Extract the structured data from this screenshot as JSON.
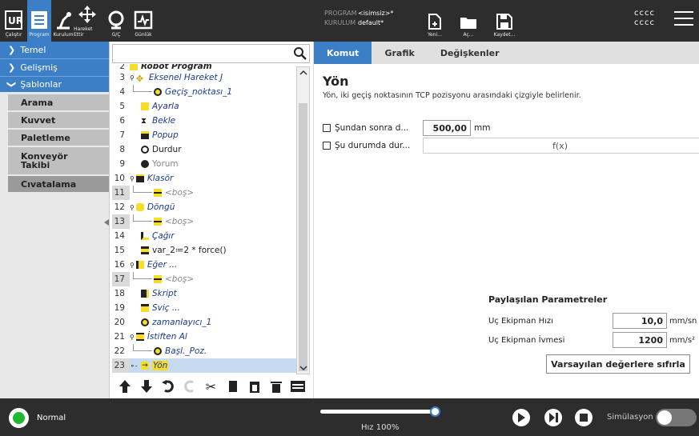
{
  "topbar": {
    "tabs": [
      {
        "label": "Çalıştır",
        "icon": "ur-logo-icon"
      },
      {
        "label": "Program",
        "icon": "program-icon"
      },
      {
        "label": "Kurulum",
        "icon": "installation-icon"
      },
      {
        "label": "Hareket Ettir",
        "icon": "move-icon"
      },
      {
        "label": "G/Ç",
        "icon": "io-icon"
      },
      {
        "label": "Günlük",
        "icon": "log-icon"
      }
    ],
    "program_key": "PROGRAM",
    "program_val": "<isimsiz>*",
    "install_key": "KURULUM",
    "install_val": "default*",
    "file_buttons": [
      {
        "label": "Yeni...",
        "icon": "new-file-icon"
      },
      {
        "label": "Aç...",
        "icon": "folder-icon"
      },
      {
        "label": "Kaydet...",
        "icon": "save-icon"
      }
    ],
    "user1": "cccc",
    "user2": "cccc"
  },
  "leftnav": {
    "top_items": [
      {
        "label": "Temel"
      },
      {
        "label": "Gelişmiş"
      },
      {
        "label": "Şablonlar"
      }
    ],
    "sub_items": [
      {
        "label": "Arama"
      },
      {
        "label": "Kuvvet"
      },
      {
        "label": "Paletleme"
      },
      {
        "label": "Konveyör Takibi"
      },
      {
        "label": "Cıvatalama"
      }
    ]
  },
  "tree": {
    "search_value": "",
    "rows": [
      {
        "n": "2",
        "label": "Robot Program",
        "icon": "robot-program-icon"
      },
      {
        "n": "3",
        "label": "Eksenel Hareket J",
        "icon": "move-icon"
      },
      {
        "n": "4",
        "label": "Geçiş_noktası_1",
        "icon": "waypoint-icon"
      },
      {
        "n": "5",
        "label": "Ayarla",
        "icon": "set-icon"
      },
      {
        "n": "6",
        "label": "Bekle",
        "icon": "wait-icon"
      },
      {
        "n": "7",
        "label": "Popup",
        "icon": "popup-icon"
      },
      {
        "n": "8",
        "label": "Durdur",
        "icon": "halt-icon"
      },
      {
        "n": "9",
        "label": "Yorum",
        "icon": "comment-icon"
      },
      {
        "n": "10",
        "label": "Klasör",
        "icon": "folder-icon"
      },
      {
        "n": "11",
        "label": "<boş>",
        "icon": "empty-icon"
      },
      {
        "n": "12",
        "label": "Döngü",
        "icon": "loop-icon"
      },
      {
        "n": "13",
        "label": "<boş>",
        "icon": "empty-icon"
      },
      {
        "n": "14",
        "label": "Çağır",
        "icon": "call-icon"
      },
      {
        "n": "15",
        "label": "var_2≔2 * force()",
        "icon": "assignment-icon"
      },
      {
        "n": "16",
        "label": "Eğer ...",
        "icon": "if-icon"
      },
      {
        "n": "17",
        "label": "<boş>",
        "icon": "empty-icon"
      },
      {
        "n": "18",
        "label": "Skript",
        "icon": "script-icon"
      },
      {
        "n": "19",
        "label": "Sviç ...",
        "icon": "switch-icon"
      },
      {
        "n": "20",
        "label": "zamanlayıcı_1",
        "icon": "timer-icon"
      },
      {
        "n": "21",
        "label": "İstiften Al",
        "icon": "destack-icon"
      },
      {
        "n": "22",
        "label": "Başl._Poz.",
        "icon": "waypoint-icon"
      },
      {
        "n": "23",
        "label": "Yön",
        "icon": "direction-icon"
      }
    ]
  },
  "right": {
    "tabs": [
      {
        "label": "Komut"
      },
      {
        "label": "Grafik"
      },
      {
        "label": "Değişkenler"
      }
    ],
    "title": "Yön",
    "description": "Yön, iki geçiş noktasının TCP pozisyonu arasındaki çizgiyle belirlenir.",
    "until_distance_label": "Şundan sonra d...",
    "until_distance_value": "500,00",
    "until_distance_unit": "mm",
    "until_condition_label": "Şu durumda dur...",
    "until_condition_value": "f(x)",
    "shared_title": "Paylaşılan Parametreler",
    "tool_speed_label": "Uç Ekipman Hızı",
    "tool_speed_value": "10,0",
    "tool_speed_unit": "mm/sn",
    "tool_accel_label": "Uç Ekipman İvmesi",
    "tool_accel_value": "1200",
    "tool_accel_unit": "mm/s²",
    "reset_label": "Varsayılan değerlere sıfırla"
  },
  "bottom": {
    "status": "Normal",
    "status_color": "#1fb82e",
    "speed_text": "Hız 100%",
    "speed_fraction": 1.0,
    "sim_label": "Simülasyon"
  }
}
